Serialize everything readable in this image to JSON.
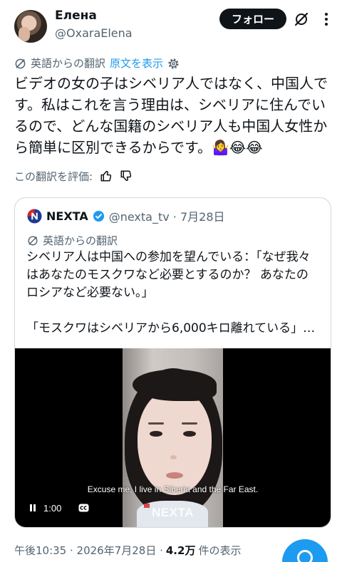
{
  "colors": {
    "text": "#0f1419",
    "secondary": "#536471",
    "accent": "#1d9bf0",
    "border": "#cfd9de",
    "follow_button_bg": "#0f1419",
    "video_bg": "#000000",
    "watermark_logo": "#d7262f"
  },
  "author": {
    "name": "Елена",
    "handle": "@OxaraElena",
    "avatar_icon": "avatar-photo"
  },
  "header": {
    "follow_label": "フォロー",
    "icons": [
      "grok-icon",
      "more-vertical-icon"
    ]
  },
  "translation": {
    "source_label": "英語からの翻訳",
    "show_original": "原文を表示",
    "icons": [
      "translate-icon",
      "gear-icon"
    ]
  },
  "post": {
    "lines": [
      "ビデオの女の子はシベリア人ではなく、中国人で",
      "す。私はこれを言う理由は、シベリアに住んでい",
      "るので、どんな国籍のシベリア人も中国人女性か",
      "ら簡単に区別できるからです。🤷‍♀️😂😂"
    ]
  },
  "rate": {
    "label": "この翻訳を評価:",
    "icons": [
      "thumbs-up-icon",
      "thumbs-down-icon"
    ]
  },
  "quote": {
    "name": "NEXTA",
    "meta": "@nexta_tv · 7月28日",
    "verified": true,
    "translation_label": "英語からの翻訳",
    "lines": [
      "シベリア人は中国への参加を望んでいる：「なぜ我々",
      "はあなたのモスクワなど必要とするのか？ あなたの",
      "ロシアなど必要ない。」",
      "",
      "「モスクワはシベリアから6,000キロ離れている」…"
    ],
    "video": {
      "subtitle": "Excuse me, I live in Siberia and the Far East.",
      "watermark": "NEXTA",
      "duration": "1:00",
      "state": "playing",
      "icons": [
        "pause-icon",
        "cc-icon"
      ]
    }
  },
  "meta": {
    "time_date": "午後10:35 · 2026年7月28日 ·",
    "views_count": "4.2万",
    "views_label": "件の表示"
  },
  "fab": {
    "icon": "grok-fab-icon"
  }
}
